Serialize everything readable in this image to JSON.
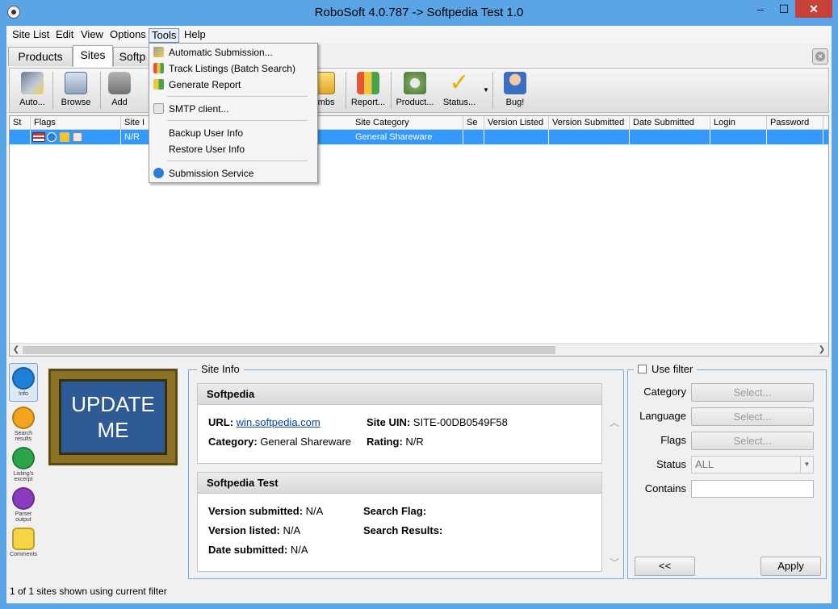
{
  "window": {
    "title": "RoboSoft 4.0.787 -> Softpedia Test 1.0",
    "min": "–",
    "max": "☐",
    "close": "✕"
  },
  "menu": {
    "site_list": "Site List",
    "edit": "Edit",
    "view": "View",
    "options": "Options",
    "tools": "Tools",
    "help": "Help"
  },
  "tabs": {
    "products": "Products",
    "sites": "Sites",
    "softpedia": "Softp"
  },
  "toolbar": {
    "auto": "Auto...",
    "browse": "Browse",
    "add": "Add",
    "thumbs": "umbs",
    "report": "Report...",
    "product": "Product...",
    "status": "Status...",
    "bug": "Bug!"
  },
  "grid": {
    "headers": {
      "st": "St",
      "flags": "Flags",
      "site": "Site I",
      "site_category": "Site Category",
      "se": "Se",
      "version_listed": "Version Listed",
      "version_submitted": "Version Submitted",
      "date_submitted": "Date Submitted",
      "login": "Login",
      "password": "Password"
    },
    "row": {
      "site": "N/R",
      "site_category": "General Shareware"
    }
  },
  "tools_menu": {
    "automatic_submission": "Automatic Submission...",
    "track_listings": "Track Listings (Batch Search)",
    "generate_report": "Generate Report",
    "smtp_client": "SMTP client...",
    "backup_user_info": "Backup User Info",
    "restore_user_info": "Restore User Info",
    "submission_service": "Submission Service"
  },
  "sidebar": {
    "info": "Info",
    "search_results": "Search results",
    "listing_excerpt": "Listing's excerpt",
    "parser_output": "Parser output",
    "comments": "Comments"
  },
  "update": {
    "line1": "UPDATE",
    "line2": "ME"
  },
  "site_info": {
    "title": "Site Info",
    "site_card": {
      "name": "Softpedia",
      "url_label": "URL:",
      "url": "win.softpedia.com",
      "uin_label": "Site UIN:",
      "uin": "SITE-00DB0549F58",
      "category_label": "Category:",
      "category": "General Shareware",
      "rating_label": "Rating:",
      "rating": "N/R"
    },
    "product_card": {
      "name": "Softpedia Test",
      "version_submitted_label": "Version submitted:",
      "version_submitted": "N/A",
      "version_listed_label": "Version listed:",
      "version_listed": "N/A",
      "date_submitted_label": "Date submitted:",
      "date_submitted": "N/A",
      "search_flag_label": "Search Flag:",
      "search_results_label": "Search Results:"
    }
  },
  "filter": {
    "use_filter": "Use filter",
    "category": "Category",
    "language": "Language",
    "flags": "Flags",
    "status": "Status",
    "contains": "Contains",
    "select": "Select...",
    "status_value": "ALL",
    "back": "<<",
    "apply": "Apply"
  },
  "statusbar": {
    "text": "1 of 1 sites shown using current filter"
  },
  "colors": {
    "titlebar": "#5ba5e6",
    "selection": "#3399ff",
    "close": "#c7403a"
  }
}
